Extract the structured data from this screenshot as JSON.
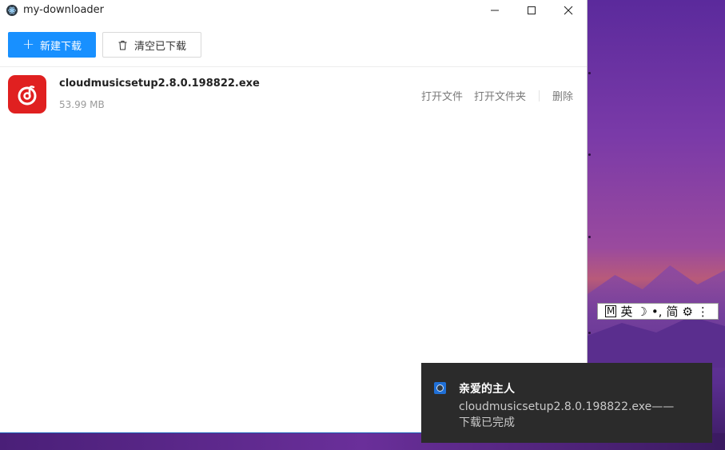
{
  "window": {
    "title": "my-downloader",
    "controls": [
      "minimize",
      "maximize",
      "close"
    ]
  },
  "toolbar": {
    "new_download_label": "新建下载",
    "clear_downloaded_label": "清空已下载"
  },
  "downloads": [
    {
      "name": "cloudmusicsetup2.8.0.198822.exe",
      "size": "53.99 MB",
      "actions": {
        "open_file": "打开文件",
        "open_folder": "打开文件夹",
        "delete": "删除"
      }
    }
  ],
  "ime": {
    "items": [
      "M",
      "英",
      "☽",
      "•,",
      "简",
      "⚙",
      "⋮"
    ]
  },
  "notification": {
    "title": "亲爱的主人",
    "message": "cloudmusicsetup2.8.0.198822.exe——下载已完成"
  },
  "colors": {
    "primary": "#1890ff",
    "app_icon_red": "#e02020",
    "toast_bg": "#2b2b2b"
  }
}
